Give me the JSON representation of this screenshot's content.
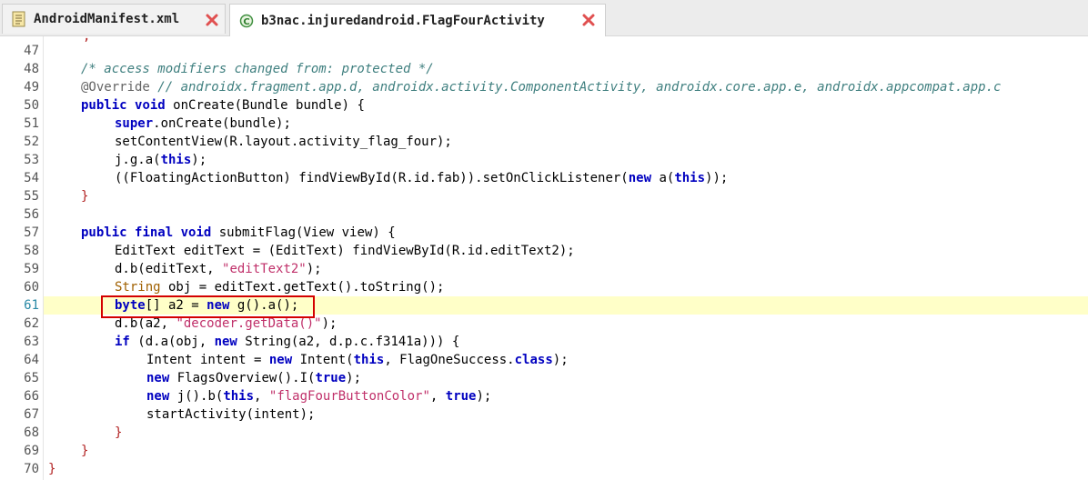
{
  "tabs": [
    {
      "label": "AndroidManifest.xml",
      "icon": "xml-file-icon",
      "active": false
    },
    {
      "label": "b3nac.injuredandroid.FlagFourActivity",
      "icon": "java-class-icon",
      "active": true
    }
  ],
  "editor": {
    "current_line": "61",
    "lines": [
      {
        "n": "47"
      },
      {
        "n": "48"
      },
      {
        "n": "49"
      },
      {
        "n": "50"
      },
      {
        "n": "51"
      },
      {
        "n": "52"
      },
      {
        "n": "53"
      },
      {
        "n": "54"
      },
      {
        "n": "55"
      },
      {
        "n": "56"
      },
      {
        "n": "57"
      },
      {
        "n": "58"
      },
      {
        "n": "59"
      },
      {
        "n": "60"
      },
      {
        "n": "61"
      },
      {
        "n": "62"
      },
      {
        "n": "63"
      },
      {
        "n": "64"
      },
      {
        "n": "65"
      },
      {
        "n": "66"
      },
      {
        "n": "67"
      },
      {
        "n": "68"
      },
      {
        "n": "69"
      },
      {
        "n": "70"
      }
    ],
    "code": {
      "l48": "/* access modifiers changed from: protected */",
      "l49_ann": "@Override",
      "l49_cm": " // androidx.fragment.app.d, androidx.activity.ComponentActivity, androidx.core.app.e, androidx.appcompat.app.c",
      "kw_public": "public",
      "kw_void": "void",
      "kw_final": "final",
      "kw_super": "super",
      "kw_this": "this",
      "kw_new": "new",
      "kw_true": "true",
      "kw_if": "if",
      "kw_byte": "byte",
      "kw_class": "class",
      "l50_rest": " onCreate(Bundle bundle) {",
      "l51_rest": ".onCreate(bundle);",
      "l52": "setContentView(R.layout.activity_flag_four);",
      "l53_a": "j.g.a(",
      "l53_b": ");",
      "l54_a": "((FloatingActionButton) findViewById(R.id.fab)).setOnClickListener(",
      "l54_b": " a(",
      "l54_c": "));",
      "l55": "}",
      "l57_rest": " submitFlag(View view) {",
      "l58": "EditText editText = (EditText) findViewById(R.id.editText2);",
      "l59_a": "d.b(editText, ",
      "l59_str": "\"editText2\"",
      "l59_b": ");",
      "l60_type": "String",
      "l60_rest": " obj = editText.getText().toString();",
      "l61_a": "[] a2 = ",
      "l61_b": " g().a();",
      "l62_a": "d.b(a2, ",
      "l62_str": "\"decoder.getData()\"",
      "l62_b": ");",
      "l63_a": " (d.a(obj, ",
      "l63_b": " String(a2, d.p.c.f3141a))) {",
      "l64_a": "Intent intent = ",
      "l64_b": " Intent(",
      "l64_c": ", FlagOneSuccess.",
      "l64_d": ");",
      "l65_a": " FlagsOverview().I(",
      "l65_b": ");",
      "l66_a": " j().b(",
      "l66_b": ", ",
      "l66_str": "\"flagFourButtonColor\"",
      "l66_c": ", ",
      "l66_d": ");",
      "l67": "startActivity(intent);",
      "l68": "}",
      "l69": "}",
      "l70": "}"
    }
  },
  "colors": {
    "keyword": "#0000c0",
    "comment": "#3f7f7f",
    "string": "#c0306a",
    "current_line_bg": "#ffffc8",
    "highlight_border": "#d40000"
  }
}
